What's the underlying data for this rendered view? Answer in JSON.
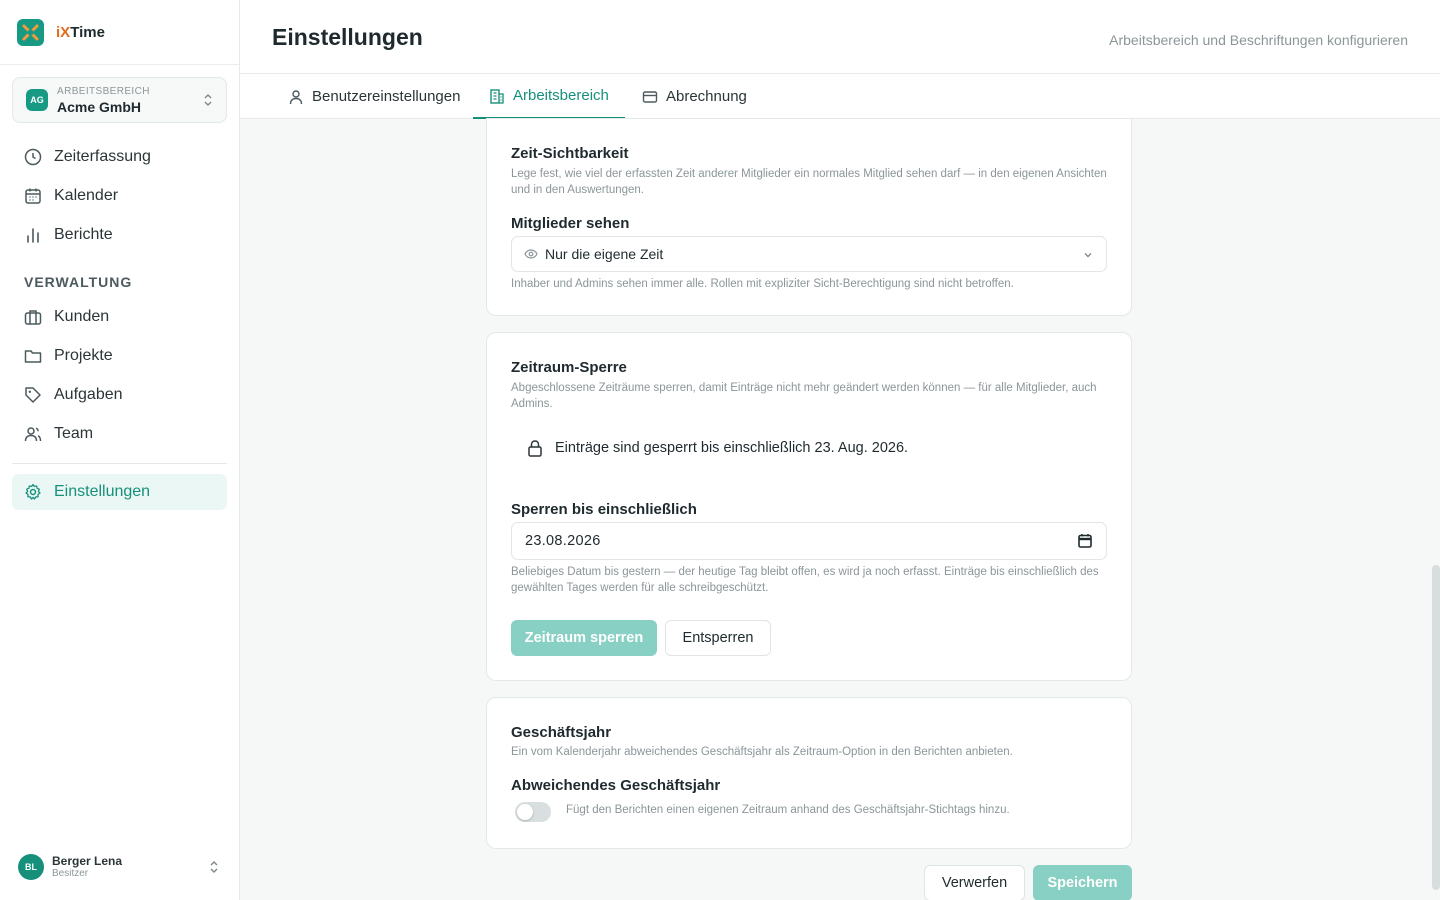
{
  "app": {
    "brand_prefix": "i",
    "brand_accent": "X",
    "brand_suffix": "Time"
  },
  "workspace": {
    "label": "ARBEITSBEREICH",
    "name": "Acme GmbH",
    "badge": "AG"
  },
  "nav": {
    "items": [
      {
        "label": "Zeiterfassung",
        "icon": "clock-icon"
      },
      {
        "label": "Kalender",
        "icon": "calendar-icon"
      },
      {
        "label": "Berichte",
        "icon": "bar-chart-icon"
      }
    ],
    "section_label": "VERWALTUNG",
    "admin_items": [
      {
        "label": "Kunden",
        "icon": "briefcase-icon"
      },
      {
        "label": "Projekte",
        "icon": "folder-icon"
      },
      {
        "label": "Aufgaben",
        "icon": "tag-icon"
      },
      {
        "label": "Team",
        "icon": "users-icon"
      }
    ],
    "settings": {
      "label": "Einstellungen",
      "icon": "gear-icon"
    }
  },
  "user": {
    "initials": "BL",
    "name": "Berger Lena",
    "role": "Besitzer"
  },
  "header": {
    "title": "Einstellungen",
    "subtitle": "Arbeitsbereich und Beschriftungen konfigurieren"
  },
  "tabs": [
    {
      "label": "Benutzereinstellungen",
      "icon": "user-icon"
    },
    {
      "label": "Arbeitsbereich",
      "icon": "building-icon",
      "active": true
    },
    {
      "label": "Abrechnung",
      "icon": "credit-card-icon"
    }
  ],
  "visibility": {
    "title": "Zeit-Sichtbarkeit",
    "description": "Lege fest, wie viel der erfassten Zeit anderer Mitglieder ein normales Mitglied sehen darf — in den eigenen Ansichten und in den Auswertungen.",
    "field_label": "Mitglieder sehen",
    "selected": "Nur die eigene Zeit",
    "hint": "Inhaber und Admins sehen immer alle. Rollen mit expliziter Sicht-Berechtigung sind nicht betroffen."
  },
  "lock": {
    "title": "Zeitraum-Sperre",
    "description": "Abgeschlossene Zeiträume sperren, damit Einträge nicht mehr geändert werden können — für alle Mitglieder, auch Admins.",
    "status": "Einträge sind gesperrt bis einschließlich 23. Aug. 2026.",
    "field_label": "Sperren bis einschließlich",
    "date_value": "23.08.2026",
    "hint": "Beliebiges Datum bis gestern — der heutige Tag bleibt offen, es wird ja noch erfasst. Einträge bis einschließlich des gewählten Tages werden für alle schreibgeschützt.",
    "lock_button": "Zeitraum sperren",
    "unlock_button": "Entsperren"
  },
  "fiscal": {
    "title": "Geschäftsjahr",
    "description": "Ein vom Kalenderjahr abweichendes Geschäftsjahr als Zeitraum-Option in den Berichten anbieten.",
    "field_label": "Abweichendes Geschäftsjahr",
    "toggle_label": "Fügt den Berichten einen eigenen Zeitraum anhand des Geschäftsjahr-Stichtags hinzu.",
    "toggle_on": false
  },
  "footer": {
    "discard": "Verwerfen",
    "save": "Speichern"
  },
  "colors": {
    "accent": "#17907b",
    "accent_light": "#88d0c3",
    "brand_orange": "#e36a1d"
  }
}
